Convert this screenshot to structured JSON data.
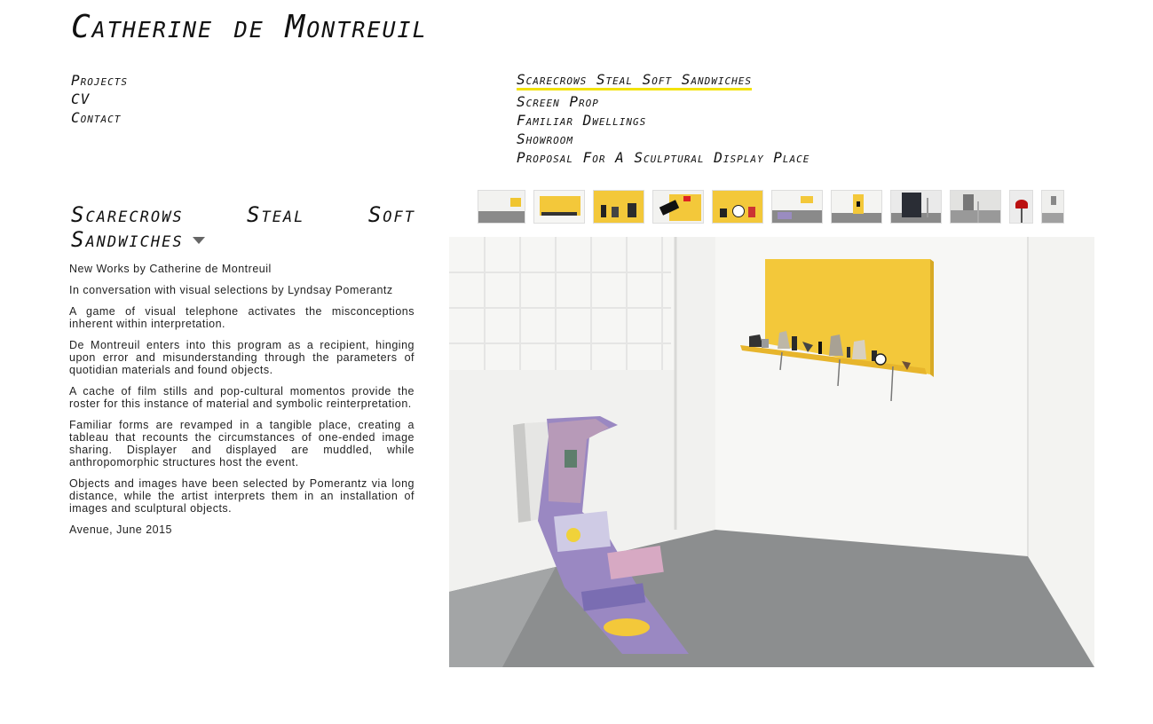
{
  "site": {
    "title": "Catherine de Montreuil"
  },
  "main_nav": [
    {
      "label": "Projects"
    },
    {
      "label": "CV"
    },
    {
      "label": "Contact"
    }
  ],
  "project_nav": [
    {
      "label": "Scarecrows Steal Soft Sandwiches",
      "active": true
    },
    {
      "label": "Screen Prop",
      "active": false
    },
    {
      "label": "Familiar Dwellings",
      "active": false
    },
    {
      "label": "Showroom",
      "active": false
    },
    {
      "label": "Proposal For A Sculptural Display Place",
      "active": false
    }
  ],
  "project": {
    "title": "Scarecrows Steal Soft Sandwiches",
    "paragraphs": [
      "New Works by Catherine de Montreuil",
      "In conversation with visual selections by Lyndsay Pomerantz",
      "A game of visual telephone activates the misconceptions inherent within interpretation.",
      "De Montreuil enters into this program as a recipient, hinging upon error and misunderstanding through the parameters of quotidian materials and found objects.",
      "A cache of film stills and pop-cultural momentos provide the roster for this instance of material and symbolic reinterpretation.",
      "Familiar forms are revamped in a tangible place, creating a tableau that recounts the circumstances of one-ended image sharing. Displayer and displayed are muddled, while anthropomorphic structures host the event.",
      "Objects and images have been selected by Pomerantz via long distance, while the artist interprets them in an installation of images and sculptural objects.",
      "Avenue, June 2015"
    ]
  },
  "colors": {
    "accent": "#f2e20a",
    "panel": "#f3c83a",
    "floor": "#8c8e8f",
    "wall": "#f4f4f2"
  },
  "thumbnails": [
    {
      "name": "thumb-wide-room"
    },
    {
      "name": "thumb-yellow-shelf"
    },
    {
      "name": "thumb-yellow-objects"
    },
    {
      "name": "thumb-black-red-objects"
    },
    {
      "name": "thumb-ball-objects"
    },
    {
      "name": "thumb-corner-room"
    },
    {
      "name": "thumb-yellow-panel-wall"
    },
    {
      "name": "thumb-dark-panel"
    },
    {
      "name": "thumb-grey-stool"
    },
    {
      "name": "thumb-red-sculpture"
    },
    {
      "name": "thumb-white-room"
    }
  ]
}
